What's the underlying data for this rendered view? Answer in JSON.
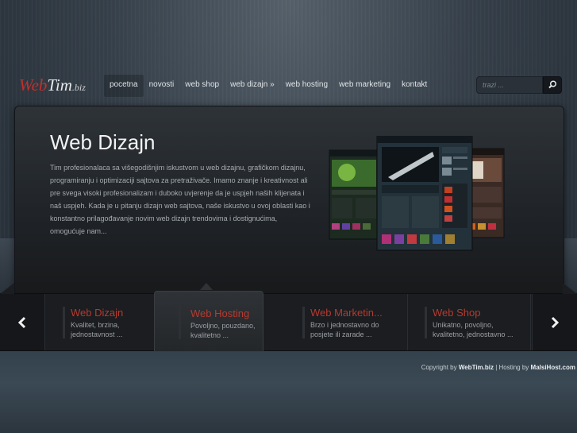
{
  "logo": {
    "web": "Web",
    "tim": "Tim",
    "biz": ".biz"
  },
  "nav": [
    "pocetna",
    "novosti",
    "web shop",
    "web dizajn »",
    "web hosting",
    "web marketing",
    "kontakt"
  ],
  "search": {
    "placeholder": "trazi ..."
  },
  "hero": {
    "title": "Web Dizajn",
    "text": "Tim profesionalaca sa višegodišnjim iskustvom u web dizajnu, grafičkom dizajnu, programiranju i optimizaciji sajtova za pretraživače. Imamo znanje i kreativnost ali pre svega visoki profesionalizam i duboko uvjerenje da je uspjeh naših klijenata i naš uspjeh. Kada je u pitanju dizajn web sajtova, naše iskustvo u ovoj oblasti kao i konstantno prilagođavanje novim web dizajn trendovima i dostignućima, omogućuje nam..."
  },
  "slides": [
    {
      "title": "Web Dizajn",
      "desc": "Kvalitet, brzina, jednostavnost ..."
    },
    {
      "title": "Web Hosting",
      "desc": "Povoljno, pouzdano, kvalitetno ..."
    },
    {
      "title": "Web Marketin...",
      "desc": "Brzo i jednostavno do posjete ili zarade ..."
    },
    {
      "title": "Web Shop",
      "desc": "Unikatno, povoljno, kvalitetno, jednostavno ..."
    }
  ],
  "footer": {
    "prefix": "Copyright by ",
    "brand": "WebTim.biz",
    "sep": " | Hosting by ",
    "host": "MalsiHost.com"
  },
  "colors": {
    "accent": "#c0302c",
    "panel": "#1f2327",
    "background": "#36404a"
  },
  "icons": {
    "search": "magnifier-icon",
    "prev": "chevron-left-icon",
    "next": "chevron-right-icon"
  }
}
